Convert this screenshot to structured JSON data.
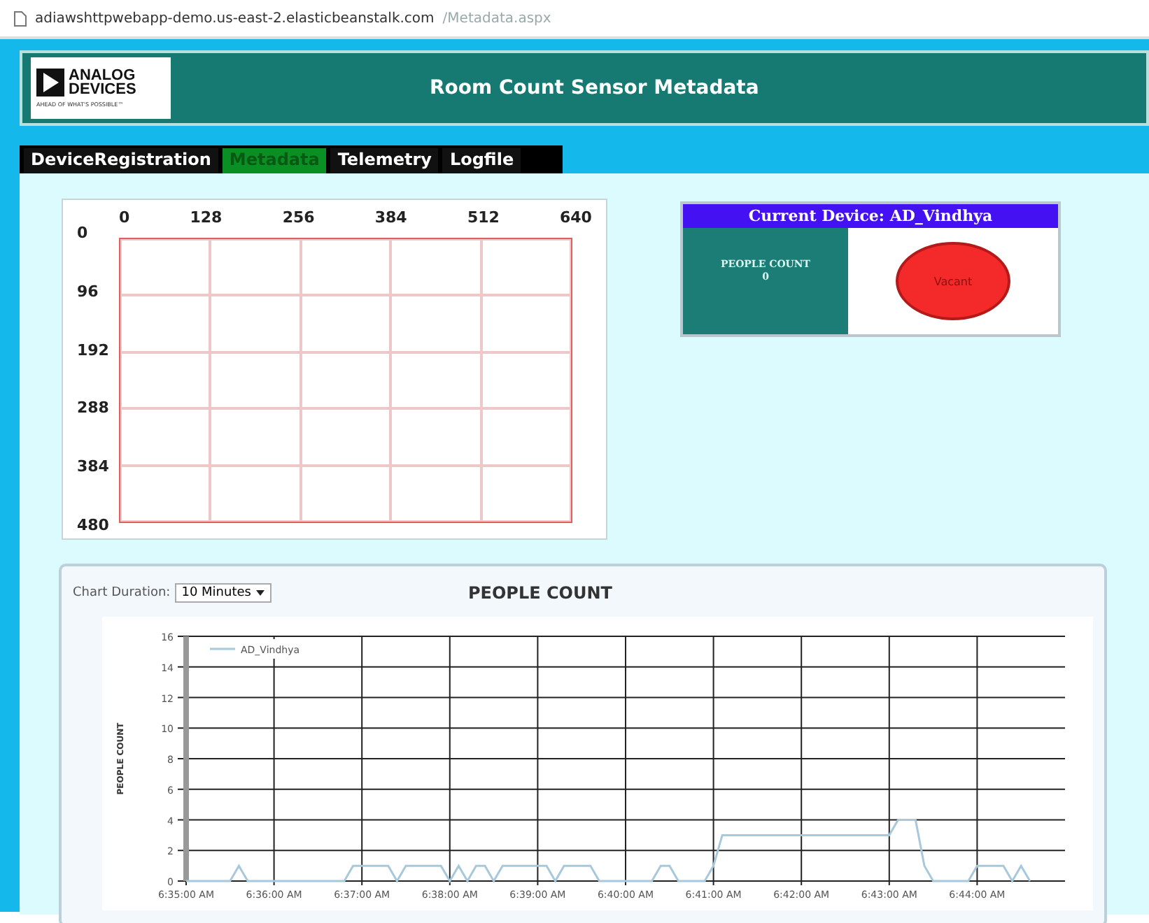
{
  "address_bar": {
    "host": "adiawshttpwebapp-demo.us-east-2.elasticbeanstalk.com",
    "path": "/Metadata.aspx"
  },
  "header": {
    "logo_line_1": "ANALOG",
    "logo_line_2": "DEVICES",
    "logo_tagline": "AHEAD OF WHAT'S POSSIBLE™",
    "title": "Room Count Sensor Metadata"
  },
  "tabs": [
    {
      "label": "DeviceRegistration",
      "selected": false
    },
    {
      "label": "Metadata",
      "selected": true
    },
    {
      "label": "Telemetry",
      "selected": false
    },
    {
      "label": "Logfile",
      "selected": false
    }
  ],
  "sensor_grid": {
    "x_labels": [
      "0",
      "128",
      "256",
      "384",
      "512",
      "640"
    ],
    "y_labels": [
      "0",
      "96",
      "192",
      "288",
      "384",
      "480"
    ]
  },
  "device": {
    "title": "Current Device: AD_Vindhya",
    "count_label": "PEOPLE COUNT",
    "count": "0",
    "occupied": false,
    "status": "Vacant"
  },
  "chart_panel": {
    "duration_label": "Chart Duration:",
    "duration_value": "10 Minutes",
    "title": "PEOPLE COUNT",
    "chart_data": {
      "type": "line",
      "grid": true,
      "ylabel": "PEOPLE COUNT",
      "ylim": [
        0,
        16
      ],
      "yticks": [
        0,
        2,
        4,
        6,
        8,
        10,
        12,
        14,
        16
      ],
      "categories": [
        "6:35:00 AM",
        null,
        null,
        null,
        null,
        null,
        null,
        null,
        null,
        null,
        "6:36:00 AM",
        null,
        null,
        null,
        null,
        null,
        null,
        null,
        null,
        null,
        "6:37:00 AM",
        null,
        null,
        null,
        null,
        null,
        null,
        null,
        null,
        null,
        "6:38:00 AM",
        null,
        null,
        null,
        null,
        null,
        null,
        null,
        null,
        null,
        "6:39:00 AM",
        null,
        null,
        null,
        null,
        null,
        null,
        null,
        null,
        null,
        "6:40:00 AM",
        null,
        null,
        null,
        null,
        null,
        null,
        null,
        null,
        null,
        "6:41:00 AM",
        null,
        null,
        null,
        null,
        null,
        null,
        null,
        null,
        null,
        "6:42:00 AM",
        null,
        null,
        null,
        null,
        null,
        null,
        null,
        null,
        null,
        "6:43:00 AM",
        null,
        null,
        null,
        null,
        null,
        null,
        null,
        null,
        null,
        "6:44:00 AM",
        null,
        null,
        null,
        null,
        null,
        null,
        null,
        null,
        null
      ],
      "series": [
        {
          "name": "AD_Vindhya",
          "color": "#a8c8dc",
          "values": [
            0,
            0,
            0,
            0,
            0,
            0,
            1,
            0,
            0,
            0,
            0,
            0,
            0,
            0,
            0,
            0,
            0,
            0,
            0,
            1,
            1,
            1,
            1,
            1,
            0,
            1,
            1,
            1,
            1,
            1,
            0,
            1,
            0,
            1,
            1,
            0,
            1,
            1,
            1,
            1,
            1,
            1,
            0,
            1,
            1,
            1,
            1,
            0,
            0,
            0,
            0,
            0,
            0,
            0,
            1,
            1,
            0,
            0,
            0,
            0,
            1,
            3,
            3,
            3,
            3,
            3,
            3,
            3,
            3,
            3,
            3,
            3,
            3,
            3,
            3,
            3,
            3,
            3,
            3,
            3,
            3,
            4,
            4,
            4,
            1,
            0,
            0,
            0,
            0,
            0,
            1,
            1,
            1,
            1,
            0,
            1,
            0,
            null,
            null,
            null
          ]
        }
      ]
    }
  }
}
